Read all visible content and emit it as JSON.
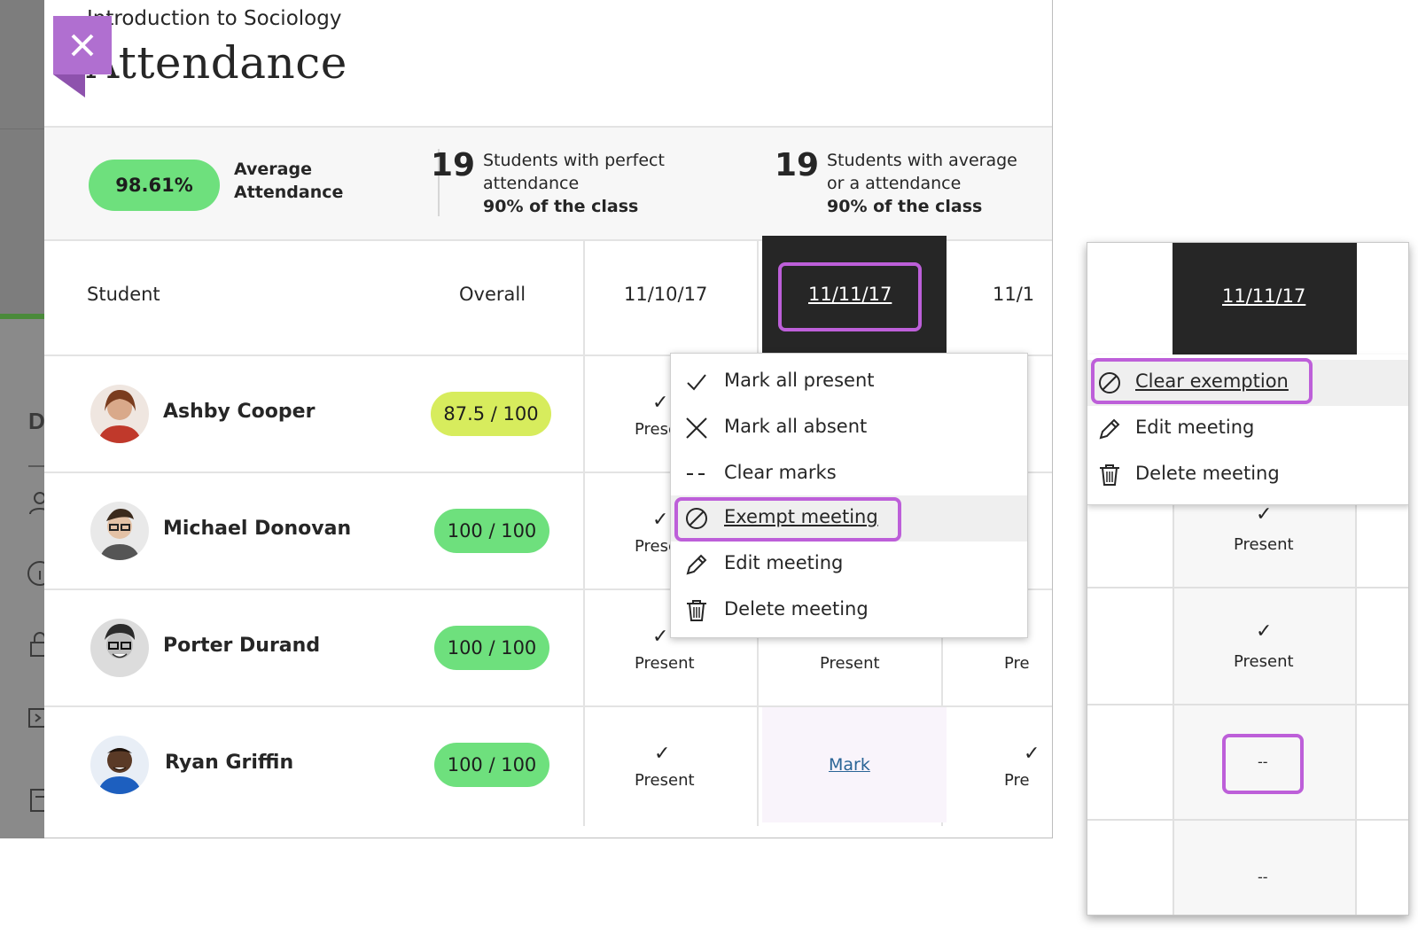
{
  "course": "Introduction to Sociology",
  "title": "Attendance",
  "summary": {
    "average_value": "98.61%",
    "average_label": "Average Attendance",
    "perfect_count": "19",
    "perfect_text": "Students with perfect attendance",
    "perfect_sub": "90% of the class",
    "above_count": "19",
    "above_text": "Students with average or a attendance",
    "above_sub": "90% of the class"
  },
  "table": {
    "col_student": "Student",
    "col_overall": "Overall",
    "dates": [
      "11/10/17",
      "11/11/17",
      "11/1"
    ],
    "rows": [
      {
        "name": "Ashby Cooper",
        "grade": "87.5 / 100",
        "grade_color": "#d7ec5d",
        "c1": "Prese"
      },
      {
        "name": "Michael Donovan",
        "grade": "100 / 100",
        "grade_color": "#6ee07d",
        "c1": "Prese"
      },
      {
        "name": "Porter Durand",
        "grade": "100 / 100",
        "grade_color": "#6ee07d",
        "c1": "Present",
        "c2": "Present",
        "c3": "Pre"
      },
      {
        "name": "Ryan Griffin",
        "grade": "100 / 100",
        "grade_color": "#6ee07d",
        "c1": "Present",
        "c2": "Mark",
        "c3": "Pre"
      }
    ]
  },
  "menu": {
    "items": [
      "Mark all present",
      "Mark all absent",
      "Clear marks",
      "Exempt meeting",
      "Edit meeting",
      "Delete meeting"
    ]
  },
  "zoom": {
    "date": "11/11/17",
    "items": [
      "Clear exemption",
      "Edit meeting",
      "Delete meeting"
    ],
    "present": "Present",
    "dash": "--"
  },
  "colors": {
    "highlight": "#bd5fd9",
    "close_button": "#b06fd0",
    "green": "#6ee07d",
    "yellow": "#d7ec5d"
  }
}
